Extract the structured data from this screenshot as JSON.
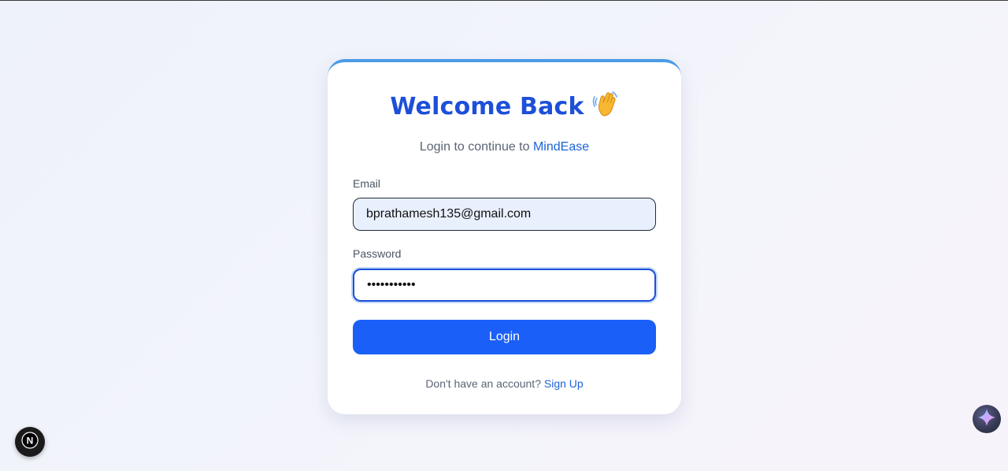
{
  "login_card": {
    "title": "Welcome Back",
    "title_emoji_icon": "waving-hand-icon",
    "subtitle_prefix": "Login to continue to ",
    "brand_name": "MindEase",
    "email_label": "Email",
    "email_value": "bprathamesh135@gmail.com",
    "password_label": "Password",
    "password_value": "•••••••••••",
    "login_button_label": "Login",
    "footer_prefix": "Don't have an account? ",
    "signup_link_label": "Sign Up"
  },
  "overlays": {
    "next_badge_icon": "nextjs-logo-icon",
    "next_badge_letter": "N",
    "sparkle_icon": "sparkle-icon"
  },
  "colors": {
    "accent": "#1a5ff8",
    "title": "#1d4fd8",
    "brand_link": "#1d63d8",
    "card_top_border": "#4a9be6"
  }
}
